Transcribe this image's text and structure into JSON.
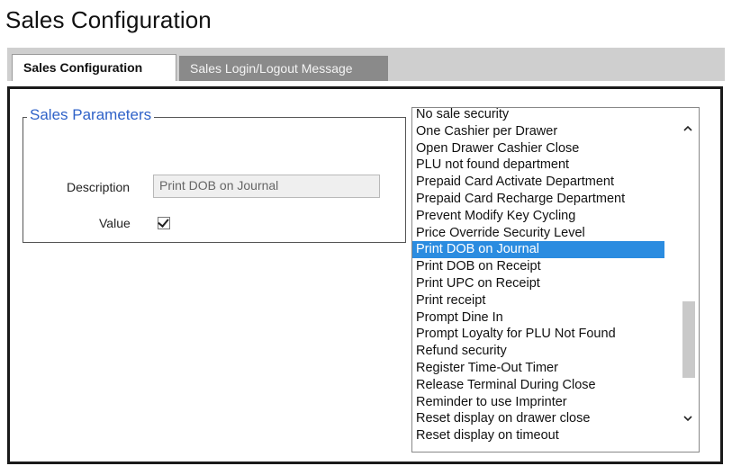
{
  "page": {
    "title": "Sales Configuration"
  },
  "tabs": [
    {
      "label": "Sales Configuration",
      "active": true
    },
    {
      "label": "Sales Login/Logout Message",
      "active": false
    }
  ],
  "parameters": {
    "legend": "Sales Parameters",
    "description_label": "Description",
    "description_value": "Print DOB on Journal",
    "value_label": "Value",
    "value_checked": true
  },
  "list": {
    "items": [
      "No sale security",
      "One Cashier per Drawer",
      "Open Drawer Cashier Close",
      "PLU not found department",
      "Prepaid Card Activate Department",
      "Prepaid Card Recharge Department",
      "Prevent Modify Key Cycling",
      "Price Override Security Level",
      "Print DOB on Journal",
      "Print DOB on Receipt",
      "Print UPC on Receipt",
      "Print receipt",
      "Prompt Dine In",
      "Prompt Loyalty for PLU Not Found",
      "Refund security",
      "Register Time-Out Timer",
      "Release Terminal During Close",
      "Reminder to use Imprinter",
      "Reset display on drawer close",
      "Reset display on timeout"
    ],
    "selected": "Print DOB on Journal",
    "icons": {
      "up": "chevron-up-icon",
      "down": "chevron-down-icon"
    }
  },
  "colors": {
    "legend": "#2f62c8",
    "selection": "#2b8ce0",
    "tabbar": "#cfcfcf",
    "inactive_tab": "#8a8a8a"
  }
}
